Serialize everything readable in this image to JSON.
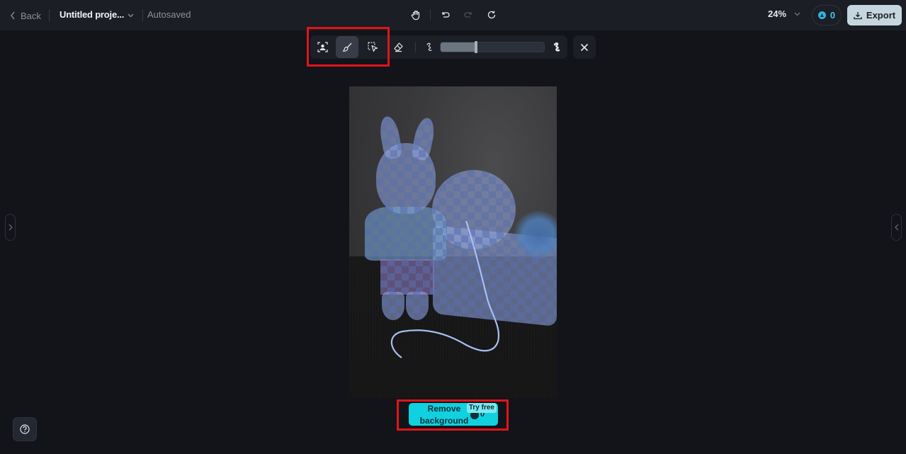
{
  "topbar": {
    "back_label": "Back",
    "project_title": "Untitled proje...",
    "save_status": "Autosaved",
    "zoom_level": "24%",
    "credits": "0",
    "export_label": "Export"
  },
  "center_tools": [
    {
      "name": "hand",
      "enabled": true
    },
    {
      "name": "undo",
      "enabled": true
    },
    {
      "name": "redo",
      "enabled": false
    },
    {
      "name": "refresh",
      "enabled": true
    }
  ],
  "mask_toolbar": {
    "tools": [
      {
        "name": "auto-subject-select",
        "active": false
      },
      {
        "name": "brush",
        "active": true
      },
      {
        "name": "lasso-select",
        "active": false
      },
      {
        "name": "eraser",
        "active": false
      }
    ],
    "brush_size_fraction": 0.34,
    "brush_size_min_icon": "thin-stroke",
    "brush_size_max_icon": "thick-stroke"
  },
  "canvas": {
    "image_subject": "knitted bunny toy with yarn ball and gift box, mask overlay"
  },
  "action": {
    "remove_bg_label": "Remove background",
    "remove_bg_badge": "Try free",
    "remove_bg_cost": "0"
  },
  "colors": {
    "accent": "#10d1e0",
    "mask_overlay": "#96aae6",
    "highlight": "#e0141a",
    "export_bg": "#c6d6de"
  }
}
